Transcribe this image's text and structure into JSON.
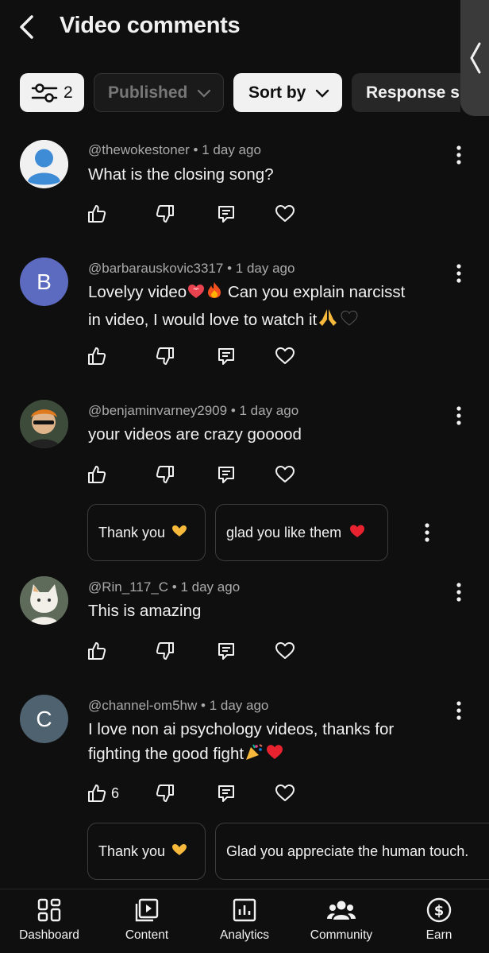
{
  "header": {
    "title": "Video comments"
  },
  "filters": {
    "filter_count": "2",
    "published_label": "Published",
    "sort_label": "Sort by",
    "response_label": "Response s"
  },
  "comments": [
    {
      "handle": "@thewokestoner",
      "time": "1 day ago",
      "text": "What is the closing song?",
      "avatar_letter": "",
      "avatar_color": "#3e8bd6"
    },
    {
      "handle": "@barbarauskovic3317",
      "time": "1 day ago",
      "text_line1": "Lovelyy video",
      "text_line1b": "Can you explain narcisst",
      "text_line2": "in video, I would love to watch it",
      "avatar_letter": "B",
      "avatar_color": "#5c6bc0"
    },
    {
      "handle": "@benjaminvarney2909",
      "time": "1 day ago",
      "text": "your videos are crazy gooood",
      "avatar_letter": "",
      "replies": [
        "Thank you",
        "glad you like them"
      ]
    },
    {
      "handle": "@Rin_117_C",
      "time": "1 day ago",
      "text": "This is amazing",
      "avatar_letter": ""
    },
    {
      "handle": "@channel-om5hw",
      "time": "1 day ago",
      "text_line1": "I love non ai psychology videos, thanks for",
      "text_line2": "fighting the good fight",
      "avatar_letter": "C",
      "avatar_color": "#4e6270",
      "like_count": "6",
      "replies": [
        "Thank you",
        "Glad you appreciate the human touch."
      ]
    }
  ],
  "nav": {
    "items": [
      {
        "label": "Dashboard",
        "icon": "dashboard-icon"
      },
      {
        "label": "Content",
        "icon": "content-icon"
      },
      {
        "label": "Analytics",
        "icon": "analytics-icon"
      },
      {
        "label": "Community",
        "icon": "community-icon"
      },
      {
        "label": "Earn",
        "icon": "earn-icon"
      }
    ]
  },
  "colors": {
    "background": "#0f0f0f",
    "chip_light": "#f1f1f1",
    "meta_text": "#aaaaaa"
  }
}
